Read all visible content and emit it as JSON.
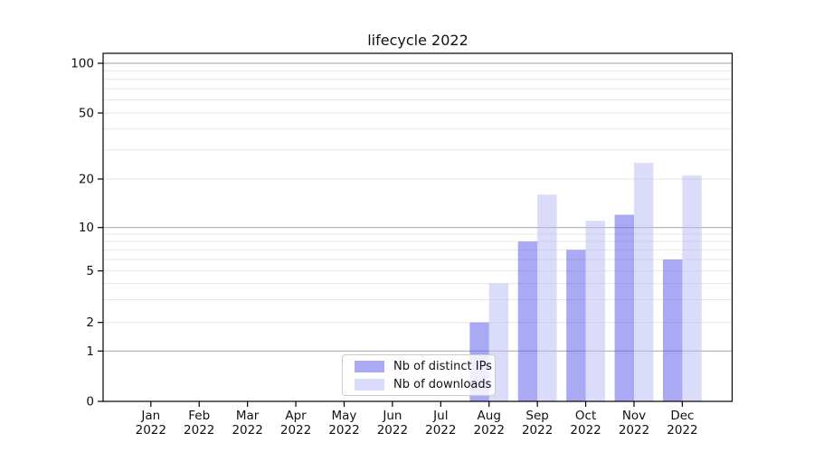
{
  "chart_data": {
    "type": "bar",
    "title": "lifecycle 2022",
    "categories": [
      "Jan",
      "Feb",
      "Mar",
      "Apr",
      "May",
      "Jun",
      "Jul",
      "Aug",
      "Sep",
      "Oct",
      "Nov",
      "Dec"
    ],
    "category_year": "2022",
    "series": [
      {
        "name": "Nb of distinct IPs",
        "color": "#a9a9f4",
        "values": [
          0,
          0,
          0,
          0,
          0,
          0,
          0,
          2,
          8,
          7,
          12,
          6
        ]
      },
      {
        "name": "Nb of downloads",
        "color": "#dbdbfa",
        "values": [
          0,
          0,
          0,
          0,
          0,
          0,
          0,
          4,
          16,
          11,
          25,
          21
        ]
      }
    ],
    "yscale": "symlog",
    "ylim": [
      0,
      115
    ],
    "y_ticks": [
      0,
      1,
      2,
      5,
      10,
      20,
      50,
      100
    ],
    "y_tick_labels": [
      "0",
      "1",
      "2",
      "5",
      "10",
      "20",
      "50",
      "100"
    ],
    "grid": {
      "major_values": [
        1,
        10,
        100
      ],
      "minor_values": [
        2,
        3,
        4,
        5,
        6,
        7,
        8,
        9,
        20,
        30,
        40,
        50,
        60,
        70,
        80,
        90
      ],
      "major_color": "#b0b0b0",
      "minor_color": "#e7e7e7"
    },
    "legend": {
      "position": "lower center",
      "border_color": "#cccccc"
    },
    "axis_color": "#000000",
    "text_color": "#111111"
  }
}
